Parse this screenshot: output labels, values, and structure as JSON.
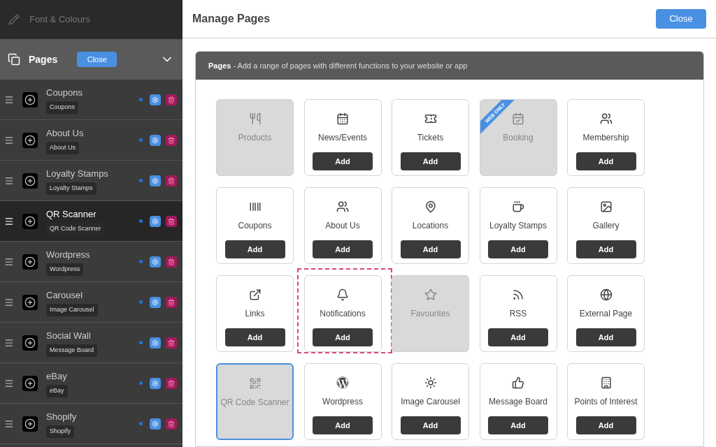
{
  "sidebar": {
    "top_item": "Font & Colours",
    "section": {
      "title": "Pages",
      "close_button": "Close",
      "expanded": true
    },
    "items": [
      {
        "title": "Coupons",
        "tag": "Coupons",
        "selected": false
      },
      {
        "title": "About Us",
        "tag": "About Us",
        "selected": false
      },
      {
        "title": "Loyalty Stamps",
        "tag": "Loyalty Stamps",
        "selected": false
      },
      {
        "title": "QR Scanner",
        "tag": "QR Code Scanner",
        "selected": true
      },
      {
        "title": "Wordpress",
        "tag": "Wordpress",
        "selected": false
      },
      {
        "title": "Carousel",
        "tag": "Image Carousel",
        "selected": false
      },
      {
        "title": "Social Wall",
        "tag": "Message Board",
        "selected": false
      },
      {
        "title": "eBay",
        "tag": "eBay",
        "selected": false
      },
      {
        "title": "Shopify",
        "tag": "Shopify",
        "selected": false
      }
    ]
  },
  "main": {
    "title": "Manage Pages",
    "close_button": "Close",
    "panel": {
      "heading": "Pages",
      "description": " - Add a range of pages with different functions to your website or app",
      "tiles": [
        {
          "label": "Products",
          "kind": "disabled"
        },
        {
          "label": "News/Events",
          "kind": "available",
          "button": "Add"
        },
        {
          "label": "Tickets",
          "kind": "available",
          "button": "Add"
        },
        {
          "label": "Booking",
          "kind": "disabled",
          "ribbon": "WEB ONLY"
        },
        {
          "label": "Membership",
          "kind": "available",
          "button": "Add"
        },
        {
          "label": "Coupons",
          "kind": "available",
          "button": "Add"
        },
        {
          "label": "About Us",
          "kind": "available",
          "button": "Add"
        },
        {
          "label": "Locations",
          "kind": "available",
          "button": "Add"
        },
        {
          "label": "Loyalty Stamps",
          "kind": "available",
          "button": "Add"
        },
        {
          "label": "Gallery",
          "kind": "available",
          "button": "Add"
        },
        {
          "label": "Links",
          "kind": "available",
          "button": "Add"
        },
        {
          "label": "Notifications",
          "kind": "available",
          "button": "Add",
          "highlighted": true
        },
        {
          "label": "Favourites",
          "kind": "disabled"
        },
        {
          "label": "RSS",
          "kind": "available",
          "button": "Add"
        },
        {
          "label": "External Page",
          "kind": "available",
          "button": "Add"
        },
        {
          "label": "QR Code Scanner",
          "kind": "selected"
        },
        {
          "label": "Wordpress",
          "kind": "available",
          "button": "Add"
        },
        {
          "label": "Image Carousel",
          "kind": "available",
          "button": "Add"
        },
        {
          "label": "Message Board",
          "kind": "available",
          "button": "Add"
        },
        {
          "label": "Points of Interest",
          "kind": "available",
          "button": "Add"
        }
      ]
    }
  }
}
